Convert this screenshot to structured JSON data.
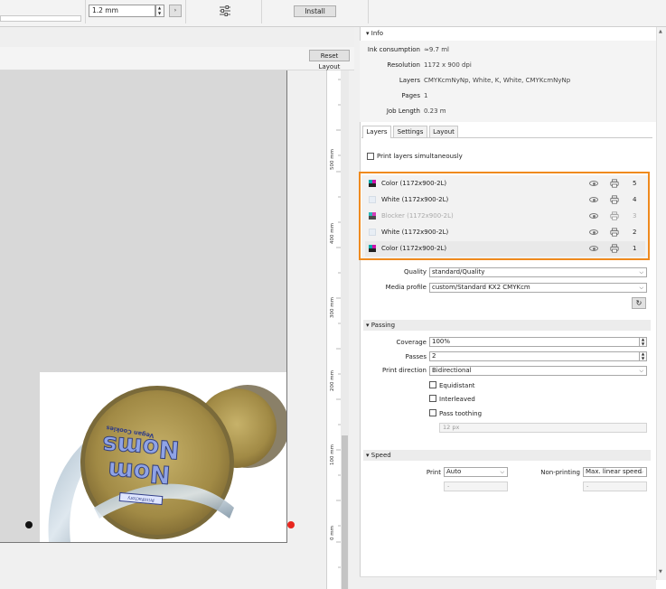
{
  "toolbar": {
    "stepper_value": "1.2 mm",
    "install_label": "Install"
  },
  "canvas": {
    "reset_layout_label": "Reset Layout",
    "ruler_labels": [
      "500 mm",
      "400 mm",
      "300 mm",
      "200 mm",
      "100 mm",
      "0 mm"
    ]
  },
  "artwork": {
    "big_text": "Nom Noms",
    "small_text": "Vegan Cookies",
    "badge": "PrintFactory"
  },
  "info": {
    "heading": "Info",
    "rows": [
      {
        "label": "Ink consumption",
        "value": "≈9.7 ml"
      },
      {
        "label": "Resolution",
        "value": "1172 x 900 dpi"
      },
      {
        "label": "Layers",
        "value": "CMYKcmNyNp, White, K, White, CMYKcmNyNp"
      },
      {
        "label": "Pages",
        "value": "1"
      },
      {
        "label": "Job Length",
        "value": "0.23 m"
      }
    ]
  },
  "tabs": [
    "Layers",
    "Settings",
    "Layout"
  ],
  "layers": {
    "print_simultaneously_label": "Print layers simultaneously",
    "items": [
      {
        "name": "Color (1172x900-2L)",
        "order": "5",
        "kind": "color",
        "enabled": true
      },
      {
        "name": "White (1172x900-2L)",
        "order": "4",
        "kind": "white",
        "enabled": true
      },
      {
        "name": "Blocker (1172x900-2L)",
        "order": "3",
        "kind": "blocker",
        "enabled": false
      },
      {
        "name": "White (1172x900-2L)",
        "order": "2",
        "kind": "white",
        "enabled": true
      },
      {
        "name": "Color (1172x900-2L)",
        "order": "1",
        "kind": "color",
        "enabled": true
      }
    ]
  },
  "quality": {
    "label": "Quality",
    "value": "standard/Quality"
  },
  "media_profile": {
    "label": "Media profile",
    "value": "custom/Standard KX2 CMYKcm"
  },
  "passing": {
    "heading": "Passing",
    "coverage_label": "Coverage",
    "coverage_value": "100%",
    "passes_label": "Passes",
    "passes_value": "2",
    "direction_label": "Print direction",
    "direction_value": "Bidirectional",
    "equidistant_label": "Equidistant",
    "interleaved_label": "Interleaved",
    "pass_toothing_label": "Pass toothing",
    "toothing_value": "12 px"
  },
  "speed": {
    "heading": "Speed",
    "print_label": "Print",
    "print_value": "Auto",
    "print_sub": "-",
    "nonprint_label": "Non-printing",
    "nonprint_value": "Max. linear speed",
    "nonprint_sub": "-"
  },
  "colors": {
    "highlight": "#ef8a1e",
    "marker_right": "#e8261f",
    "marker_left": "#111111"
  }
}
